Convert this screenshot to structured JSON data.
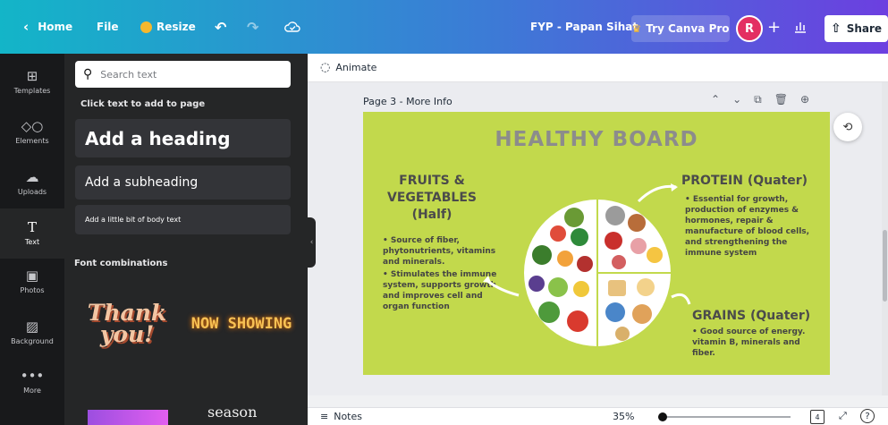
{
  "topbar": {
    "home_label": "Home",
    "file_label": "File",
    "resize_label": "Resize",
    "doc_title": "FYP - Papan Sihat",
    "try_pro_label": "Try Canva Pro",
    "avatar_initial": "R",
    "share_label": "Share"
  },
  "rail": {
    "items": [
      {
        "label": "Templates",
        "icon": "templates-icon"
      },
      {
        "label": "Elements",
        "icon": "elements-icon"
      },
      {
        "label": "Uploads",
        "icon": "uploads-icon"
      },
      {
        "label": "Text",
        "icon": "text-icon"
      },
      {
        "label": "Photos",
        "icon": "photos-icon"
      },
      {
        "label": "Background",
        "icon": "background-icon"
      },
      {
        "label": "More",
        "icon": "more-icon"
      }
    ]
  },
  "panel": {
    "search_placeholder": "Search text",
    "hint": "Click text to add to page",
    "heading": "Add a heading",
    "subheading": "Add a subheading",
    "body": "Add a little bit of body text",
    "font_combinations": "Font combinations",
    "thumb_thank_you": "Thank you!",
    "thumb_now_showing": "NOW SHOWING",
    "thumb_season": "season"
  },
  "editor": {
    "animate_label": "Animate",
    "page_label": "Page 3 - More Info",
    "notes_label": "Notes",
    "zoom": "35%",
    "page_count": "4",
    "zoom_fraction": 0.35
  },
  "poster": {
    "title": "HEALTHY BOARD",
    "fruits_title": "FRUITS & VEGETABLES (Half)",
    "fruits_bullets": [
      "Source of fiber, phytonutrients, vitamins and minerals.",
      "Stimulates the immune system, supports growth and improves cell and organ function"
    ],
    "protein_title": "PROTEIN (Quater)",
    "protein_bullet": "Essential for growth, production of enzymes & hormones, repair & manufacture of blood cells, and strengthening the immune system",
    "grains_title": "GRAINS (Quater)",
    "grains_bullet": "Good source of energy. vitamin B, minerals and fiber."
  },
  "colors": {
    "canvas_bg": "#c2d94c",
    "title_gray": "#8c8c8c",
    "avatar": "#e32f62"
  }
}
